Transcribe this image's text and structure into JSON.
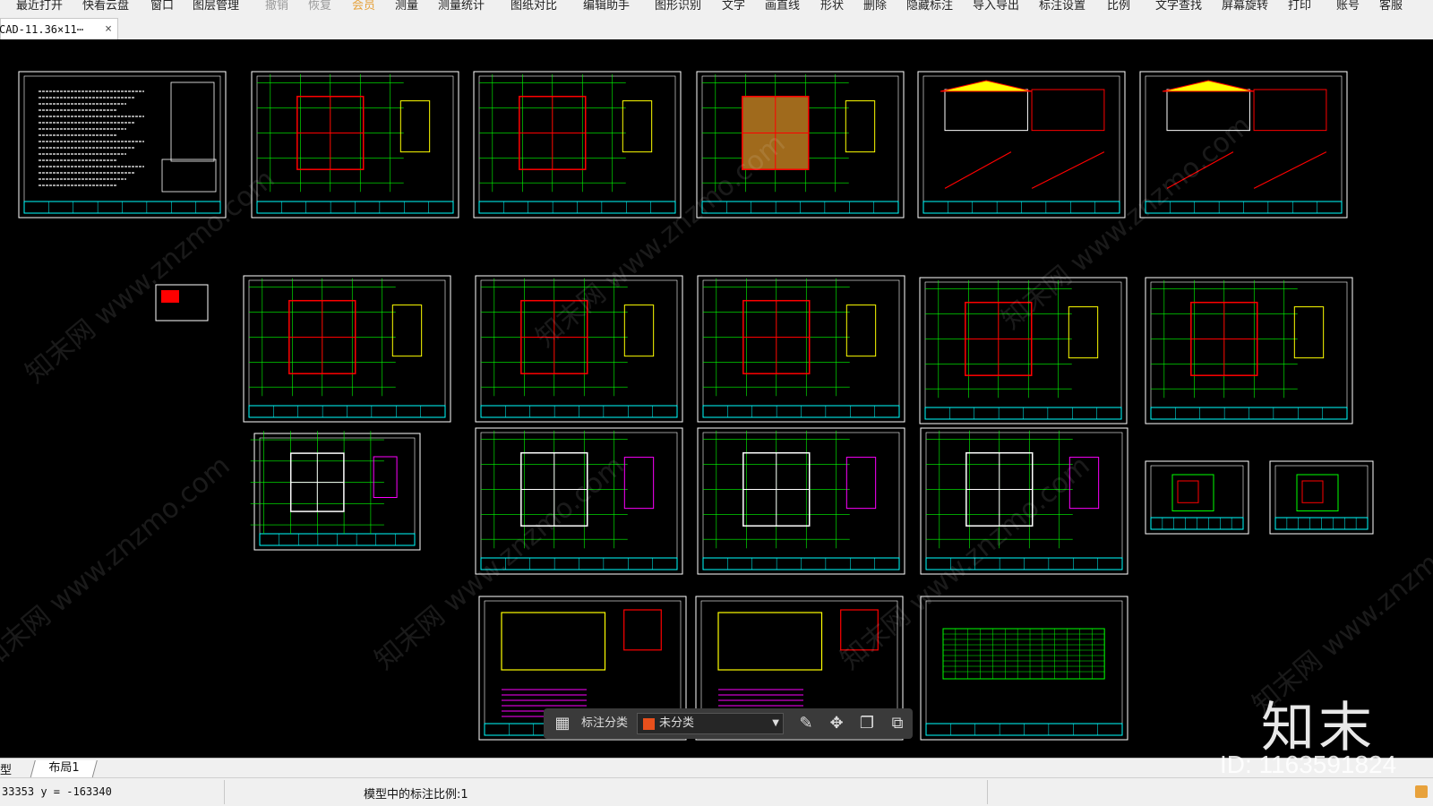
{
  "menu": {
    "items": [
      "最近打开",
      "快看云盘",
      "窗口",
      "图层管理",
      "撤销",
      "恢复",
      "会员",
      "测量",
      "测量统计",
      "图纸对比",
      "编辑助手",
      "图形识别",
      "文字",
      "画直线",
      "形状",
      "删除",
      "隐藏标注",
      "导入导出",
      "标注设置",
      "比例",
      "文字查找",
      "屏幕旋转",
      "打印",
      "账号",
      "客服"
    ]
  },
  "tab": {
    "title": "CAD-11.36×11⋯",
    "close": "×"
  },
  "annotate_bar": {
    "label": "标注分类",
    "category": "未分类",
    "swatch_color": "#e8501c"
  },
  "layout_tabs": {
    "model": "型",
    "layout1": "布局1"
  },
  "status": {
    "coords": "33353 y = -163340",
    "scale": "模型中的标注比例:1"
  },
  "watermark": {
    "logo": "知末",
    "id": "ID: 1163591824",
    "faint": "知末网 www.znzmo.com"
  },
  "colors": {
    "sheet_border": "#ffffff",
    "title_strip": "#00ffff",
    "grid": "#00ff00",
    "walls": "#ff0000",
    "accent": "#ff00ff",
    "yellow": "#ffff00",
    "canvas": "#000000"
  }
}
